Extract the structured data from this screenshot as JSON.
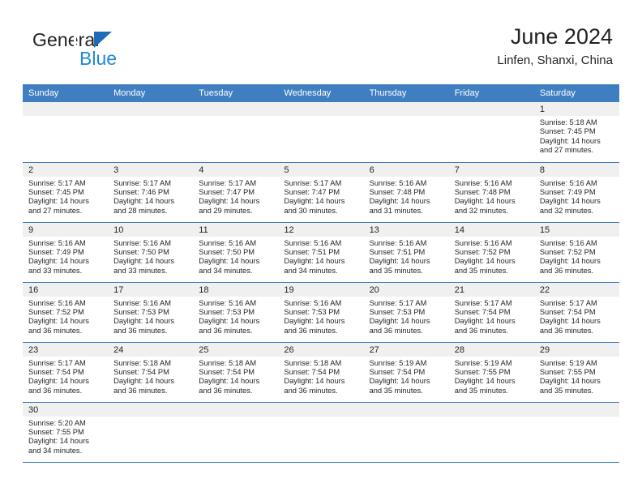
{
  "logo": {
    "word1": "General",
    "word2": "Blue",
    "triangle_color": "#1e6bb8",
    "blue_color": "#1e88d6"
  },
  "header": {
    "title": "June 2024",
    "subtitle": "Linfen, Shanxi, China"
  },
  "theme": {
    "header_blue": "#3f7fc1",
    "daynum_bg": "#f0f0f0",
    "text": "#231f20"
  },
  "weekday_headers": [
    "Sunday",
    "Monday",
    "Tuesday",
    "Wednesday",
    "Thursday",
    "Friday",
    "Saturday"
  ],
  "labels": {
    "sunrise_prefix": "Sunrise:",
    "sunset_prefix": "Sunset:",
    "daylight_prefix": "Daylight:"
  },
  "weeks": [
    [
      {
        "day": "",
        "empty": true
      },
      {
        "day": "",
        "empty": true
      },
      {
        "day": "",
        "empty": true
      },
      {
        "day": "",
        "empty": true
      },
      {
        "day": "",
        "empty": true
      },
      {
        "day": "",
        "empty": true
      },
      {
        "day": "1",
        "sunrise": "Sunrise: 5:18 AM",
        "sunset": "Sunset: 7:45 PM",
        "daylight_l1": "Daylight: 14 hours",
        "daylight_l2": "and 27 minutes."
      }
    ],
    [
      {
        "day": "2",
        "sunrise": "Sunrise: 5:17 AM",
        "sunset": "Sunset: 7:45 PM",
        "daylight_l1": "Daylight: 14 hours",
        "daylight_l2": "and 27 minutes."
      },
      {
        "day": "3",
        "sunrise": "Sunrise: 5:17 AM",
        "sunset": "Sunset: 7:46 PM",
        "daylight_l1": "Daylight: 14 hours",
        "daylight_l2": "and 28 minutes."
      },
      {
        "day": "4",
        "sunrise": "Sunrise: 5:17 AM",
        "sunset": "Sunset: 7:47 PM",
        "daylight_l1": "Daylight: 14 hours",
        "daylight_l2": "and 29 minutes."
      },
      {
        "day": "5",
        "sunrise": "Sunrise: 5:17 AM",
        "sunset": "Sunset: 7:47 PM",
        "daylight_l1": "Daylight: 14 hours",
        "daylight_l2": "and 30 minutes."
      },
      {
        "day": "6",
        "sunrise": "Sunrise: 5:16 AM",
        "sunset": "Sunset: 7:48 PM",
        "daylight_l1": "Daylight: 14 hours",
        "daylight_l2": "and 31 minutes."
      },
      {
        "day": "7",
        "sunrise": "Sunrise: 5:16 AM",
        "sunset": "Sunset: 7:48 PM",
        "daylight_l1": "Daylight: 14 hours",
        "daylight_l2": "and 32 minutes."
      },
      {
        "day": "8",
        "sunrise": "Sunrise: 5:16 AM",
        "sunset": "Sunset: 7:49 PM",
        "daylight_l1": "Daylight: 14 hours",
        "daylight_l2": "and 32 minutes."
      }
    ],
    [
      {
        "day": "9",
        "sunrise": "Sunrise: 5:16 AM",
        "sunset": "Sunset: 7:49 PM",
        "daylight_l1": "Daylight: 14 hours",
        "daylight_l2": "and 33 minutes."
      },
      {
        "day": "10",
        "sunrise": "Sunrise: 5:16 AM",
        "sunset": "Sunset: 7:50 PM",
        "daylight_l1": "Daylight: 14 hours",
        "daylight_l2": "and 33 minutes."
      },
      {
        "day": "11",
        "sunrise": "Sunrise: 5:16 AM",
        "sunset": "Sunset: 7:50 PM",
        "daylight_l1": "Daylight: 14 hours",
        "daylight_l2": "and 34 minutes."
      },
      {
        "day": "12",
        "sunrise": "Sunrise: 5:16 AM",
        "sunset": "Sunset: 7:51 PM",
        "daylight_l1": "Daylight: 14 hours",
        "daylight_l2": "and 34 minutes."
      },
      {
        "day": "13",
        "sunrise": "Sunrise: 5:16 AM",
        "sunset": "Sunset: 7:51 PM",
        "daylight_l1": "Daylight: 14 hours",
        "daylight_l2": "and 35 minutes."
      },
      {
        "day": "14",
        "sunrise": "Sunrise: 5:16 AM",
        "sunset": "Sunset: 7:52 PM",
        "daylight_l1": "Daylight: 14 hours",
        "daylight_l2": "and 35 minutes."
      },
      {
        "day": "15",
        "sunrise": "Sunrise: 5:16 AM",
        "sunset": "Sunset: 7:52 PM",
        "daylight_l1": "Daylight: 14 hours",
        "daylight_l2": "and 36 minutes."
      }
    ],
    [
      {
        "day": "16",
        "sunrise": "Sunrise: 5:16 AM",
        "sunset": "Sunset: 7:52 PM",
        "daylight_l1": "Daylight: 14 hours",
        "daylight_l2": "and 36 minutes."
      },
      {
        "day": "17",
        "sunrise": "Sunrise: 5:16 AM",
        "sunset": "Sunset: 7:53 PM",
        "daylight_l1": "Daylight: 14 hours",
        "daylight_l2": "and 36 minutes."
      },
      {
        "day": "18",
        "sunrise": "Sunrise: 5:16 AM",
        "sunset": "Sunset: 7:53 PM",
        "daylight_l1": "Daylight: 14 hours",
        "daylight_l2": "and 36 minutes."
      },
      {
        "day": "19",
        "sunrise": "Sunrise: 5:16 AM",
        "sunset": "Sunset: 7:53 PM",
        "daylight_l1": "Daylight: 14 hours",
        "daylight_l2": "and 36 minutes."
      },
      {
        "day": "20",
        "sunrise": "Sunrise: 5:17 AM",
        "sunset": "Sunset: 7:53 PM",
        "daylight_l1": "Daylight: 14 hours",
        "daylight_l2": "and 36 minutes."
      },
      {
        "day": "21",
        "sunrise": "Sunrise: 5:17 AM",
        "sunset": "Sunset: 7:54 PM",
        "daylight_l1": "Daylight: 14 hours",
        "daylight_l2": "and 36 minutes."
      },
      {
        "day": "22",
        "sunrise": "Sunrise: 5:17 AM",
        "sunset": "Sunset: 7:54 PM",
        "daylight_l1": "Daylight: 14 hours",
        "daylight_l2": "and 36 minutes."
      }
    ],
    [
      {
        "day": "23",
        "sunrise": "Sunrise: 5:17 AM",
        "sunset": "Sunset: 7:54 PM",
        "daylight_l1": "Daylight: 14 hours",
        "daylight_l2": "and 36 minutes."
      },
      {
        "day": "24",
        "sunrise": "Sunrise: 5:18 AM",
        "sunset": "Sunset: 7:54 PM",
        "daylight_l1": "Daylight: 14 hours",
        "daylight_l2": "and 36 minutes."
      },
      {
        "day": "25",
        "sunrise": "Sunrise: 5:18 AM",
        "sunset": "Sunset: 7:54 PM",
        "daylight_l1": "Daylight: 14 hours",
        "daylight_l2": "and 36 minutes."
      },
      {
        "day": "26",
        "sunrise": "Sunrise: 5:18 AM",
        "sunset": "Sunset: 7:54 PM",
        "daylight_l1": "Daylight: 14 hours",
        "daylight_l2": "and 36 minutes."
      },
      {
        "day": "27",
        "sunrise": "Sunrise: 5:19 AM",
        "sunset": "Sunset: 7:54 PM",
        "daylight_l1": "Daylight: 14 hours",
        "daylight_l2": "and 35 minutes."
      },
      {
        "day": "28",
        "sunrise": "Sunrise: 5:19 AM",
        "sunset": "Sunset: 7:55 PM",
        "daylight_l1": "Daylight: 14 hours",
        "daylight_l2": "and 35 minutes."
      },
      {
        "day": "29",
        "sunrise": "Sunrise: 5:19 AM",
        "sunset": "Sunset: 7:55 PM",
        "daylight_l1": "Daylight: 14 hours",
        "daylight_l2": "and 35 minutes."
      }
    ],
    [
      {
        "day": "30",
        "sunrise": "Sunrise: 5:20 AM",
        "sunset": "Sunset: 7:55 PM",
        "daylight_l1": "Daylight: 14 hours",
        "daylight_l2": "and 34 minutes."
      },
      {
        "day": "",
        "empty": true
      },
      {
        "day": "",
        "empty": true
      },
      {
        "day": "",
        "empty": true
      },
      {
        "day": "",
        "empty": true
      },
      {
        "day": "",
        "empty": true
      },
      {
        "day": "",
        "empty": true
      }
    ]
  ]
}
